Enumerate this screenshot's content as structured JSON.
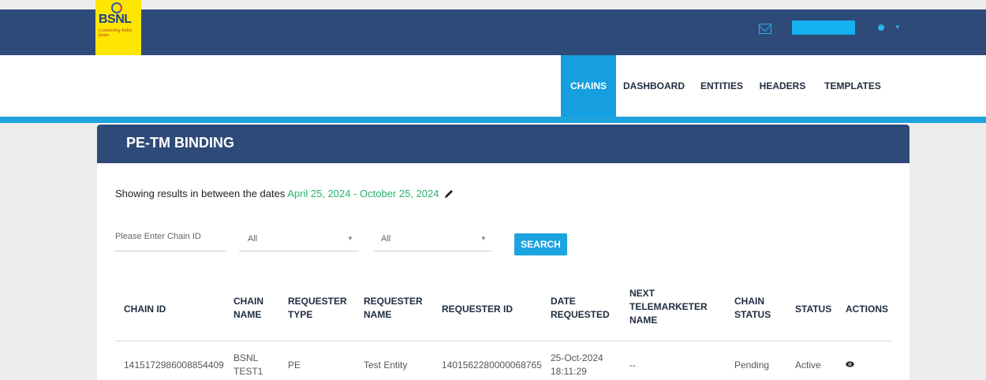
{
  "brand": {
    "name": "BSNL",
    "tagline": "Connecting India faster"
  },
  "nav": {
    "items": [
      {
        "label": "CHAINS",
        "active": true
      },
      {
        "label": "DASHBOARD",
        "active": false
      },
      {
        "label": "ENTITIES",
        "active": false
      },
      {
        "label": "HEADERS",
        "active": false
      },
      {
        "label": "TEMPLATES",
        "active": false
      }
    ]
  },
  "page": {
    "title": "PE-TM BINDING",
    "dates_prefix": "Showing results in between the dates",
    "dates_range": "April 25, 2024 - October 25, 2024"
  },
  "filters": {
    "chain_id_placeholder": "Please Enter Chain ID",
    "select_one": "All",
    "select_two": "All",
    "search_label": "SEARCH"
  },
  "table": {
    "columns": [
      "CHAIN ID",
      "CHAIN NAME",
      "REQUESTER TYPE",
      "REQUESTER NAME",
      "REQUESTER ID",
      "DATE REQUESTED",
      "NEXT TELEMARKETER NAME",
      "CHAIN STATUS",
      "STATUS",
      "ACTIONS"
    ],
    "rows": [
      {
        "chain_id": "1415172986008854409",
        "chain_name": "BSNL TEST1",
        "requester_type": "PE",
        "requester_name": "Test Entity",
        "requester_id": "1401562280000068765",
        "date_requested": "25-Oct-2024 18:11:29",
        "next_telemarketer": "--",
        "chain_status": "Pending",
        "status": "Active",
        "action_icon": "eye-icon"
      }
    ]
  },
  "colors": {
    "header_bg": "#2e4a78",
    "accent_blue": "#159fe0",
    "date_green": "#27b36a",
    "logo_yellow": "#ffe600"
  }
}
